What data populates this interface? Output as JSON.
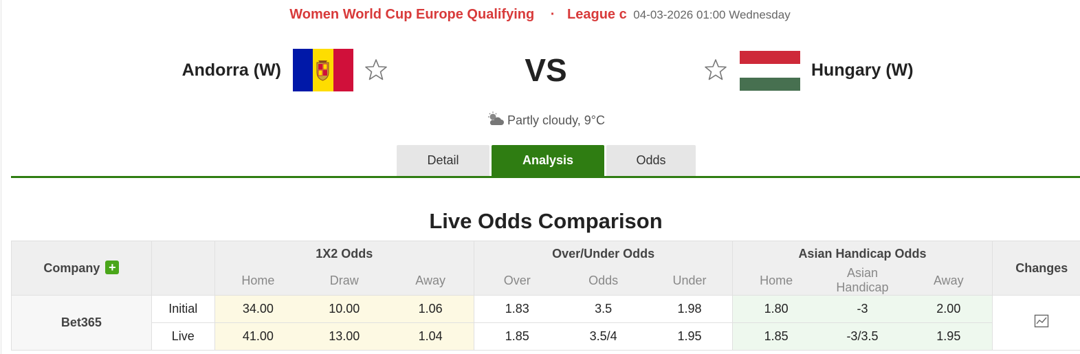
{
  "match": {
    "league": "Women World Cup Europe Qualifying",
    "separator": "·",
    "league_stage": "League c",
    "datetime": "04-03-2026 01:00 Wednesday",
    "home_team": "Andorra (W)",
    "away_team": "Hungary (W)",
    "vs": "VS",
    "weather": "Partly cloudy, 9°C"
  },
  "flags": {
    "andorra": [
      "#0018a8",
      "#fedd00",
      "#d0103a"
    ],
    "hungary": [
      "#ce2939",
      "#ffffff",
      "#477050"
    ]
  },
  "tabs": [
    {
      "label": "Detail",
      "active": false
    },
    {
      "label": "Analysis",
      "active": true
    },
    {
      "label": "Odds",
      "active": false
    }
  ],
  "section_title": "Live Odds Comparison",
  "table": {
    "company_header": "Company",
    "add_label": "+",
    "groups": {
      "x12": "1X2 Odds",
      "ou": "Over/Under Odds",
      "ah": "Asian Handicap Odds",
      "changes": "Changes"
    },
    "sub_headers": {
      "x12": [
        "Home",
        "Draw",
        "Away"
      ],
      "ou": [
        "Over",
        "Odds",
        "Under"
      ],
      "ah": [
        "Home",
        "Asian Handicap",
        "Away"
      ]
    },
    "company": "Bet365",
    "rows": [
      {
        "type": "Initial",
        "x12": [
          "34.00",
          "10.00",
          "1.06"
        ],
        "ou": [
          "1.83",
          "3.5",
          "1.98"
        ],
        "ah": [
          "1.80",
          "-3",
          "2.00"
        ]
      },
      {
        "type": "Live",
        "x12": [
          "41.00",
          "13.00",
          "1.04"
        ],
        "ou": [
          "1.85",
          "3.5/4",
          "1.95"
        ],
        "ah": [
          "1.85",
          "-3/3.5",
          "1.95"
        ]
      }
    ]
  },
  "colors": {
    "accent_green": "#2f7d12",
    "league_red": "#d83a3a"
  }
}
